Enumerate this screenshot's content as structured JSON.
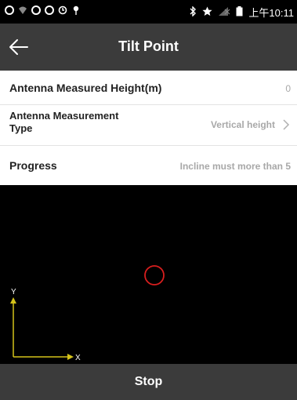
{
  "status_bar": {
    "icons": [
      "sync-icon",
      "wifi-icon",
      "sync-icon",
      "sync-icon",
      "alarm-icon",
      "location-icon"
    ],
    "right_icons": [
      "bluetooth-icon",
      "star-icon",
      "no-signal-icon",
      "battery-icon"
    ],
    "time": "上午10:11"
  },
  "app_bar": {
    "title": "Tilt Point",
    "back_icon": "arrow-left-icon"
  },
  "settings": {
    "rows": [
      {
        "label": "Antenna Measured Height(m)",
        "value": "0"
      },
      {
        "label": "Antenna Measurement Type",
        "value": "Vertical height"
      },
      {
        "label": "Progress",
        "value": "Incline must more than 5"
      }
    ]
  },
  "canvas": {
    "axis_y_label": "Y",
    "axis_x_label": "X",
    "axis_color": "#d4c21a",
    "marker_color": "#d81e1e"
  },
  "footer": {
    "stop_label": "Stop"
  },
  "colors": {
    "bar": "#3b3b3b",
    "value_text": "#a8a8a8"
  }
}
